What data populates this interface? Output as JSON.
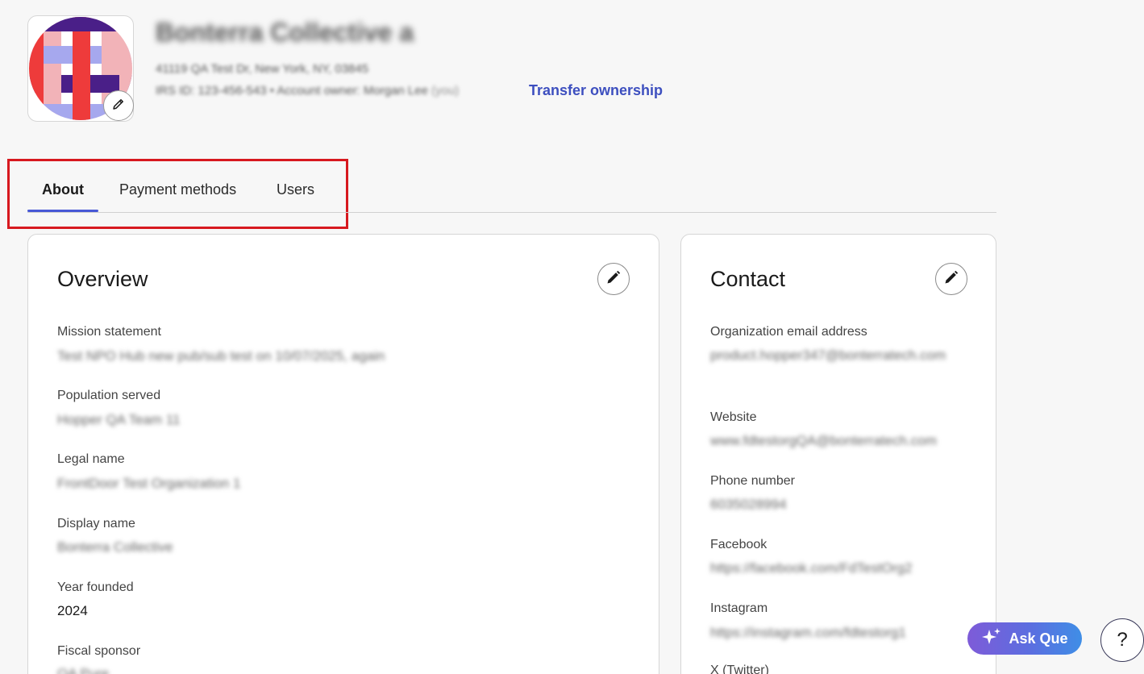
{
  "org": {
    "name": "Bonterra Collective a",
    "address": "41119 QA Test Dr, New York, NY, 03845",
    "ids": "IRS ID: 123-456-543 • Account owner: Morgan Lee",
    "you_tag": "(you)",
    "transfer_link": "Transfer ownership",
    "avatar_edit_icon": "pencil-icon"
  },
  "tabs": [
    {
      "label": "About",
      "active": true
    },
    {
      "label": "Payment methods",
      "active": false
    },
    {
      "label": "Users",
      "active": false
    }
  ],
  "overview": {
    "title": "Overview",
    "edit_icon": "pencil-icon",
    "fields": [
      {
        "label": "Mission statement",
        "value": "Test NPO Hub new pub/sub test on 10/07/2025, again"
      },
      {
        "label": "Population served",
        "value": "Hopper QA Team 11"
      },
      {
        "label": "Legal name",
        "value": "FrontDoor Test Organization 1"
      },
      {
        "label": "Display name",
        "value": "Bonterra Collective"
      },
      {
        "label": "Year founded",
        "value": "2024"
      },
      {
        "label": "Fiscal sponsor",
        "value": "QA Pure"
      }
    ]
  },
  "contact": {
    "title": "Contact",
    "edit_icon": "pencil-icon",
    "fields": [
      {
        "label": "Organization email address",
        "value": "product.hopper347@bonterratech.com"
      },
      {
        "label": "Website",
        "value": "www.fdtestorgQA@bonterratech.com"
      },
      {
        "label": "Phone number",
        "value": "6035028994"
      },
      {
        "label": "Facebook",
        "value": "https://facebook.com/FdTestOrg2"
      },
      {
        "label": "Instagram",
        "value": "https://instagram.com/fdtestorg1"
      },
      {
        "label": "X (Twitter)",
        "value": ""
      }
    ]
  },
  "assistant": {
    "label": "Ask Que",
    "icon": "sparkle-icon"
  },
  "help": {
    "label": "?"
  },
  "colors": {
    "accent": "#4758d6",
    "link": "#3d4fbf",
    "highlight_box": "#d7191f"
  }
}
